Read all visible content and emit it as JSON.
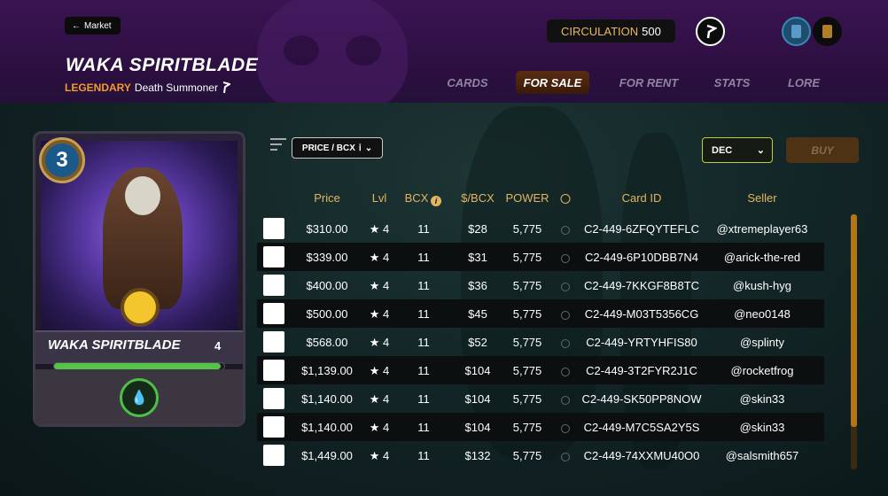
{
  "header": {
    "back_label": "Market",
    "title": "WAKA SPIRITBLADE",
    "rarity": "LEGENDARY",
    "class": "Death Summoner",
    "circulation_label": "CIRCULATION",
    "circulation_value": "500"
  },
  "tabs": [
    {
      "label": "CARDS",
      "active": false
    },
    {
      "label": "FOR SALE",
      "active": true
    },
    {
      "label": "FOR RENT",
      "active": false
    },
    {
      "label": "STATS",
      "active": false
    },
    {
      "label": "LORE",
      "active": false
    }
  ],
  "card": {
    "mana": "3",
    "name": "WAKA SPIRITBLADE",
    "level": "4",
    "xp_fraction": 0.98
  },
  "controls": {
    "sort_label": "PRICE / BCX",
    "order_label": "DEC",
    "buy_label": "BUY"
  },
  "table": {
    "headers": {
      "price": "Price",
      "lvl": "Lvl",
      "bcx": "BCX",
      "per_bcx": "$/BCX",
      "power": "POWER",
      "card_id": "Card ID",
      "seller": "Seller"
    },
    "rows": [
      {
        "price": "$310.00",
        "lvl": "★ 4",
        "bcx": "11",
        "per_bcx": "$28",
        "power": "5,775",
        "card_id": "C2-449-6ZFQYTEFLC",
        "seller": "@xtremeplayer63"
      },
      {
        "price": "$339.00",
        "lvl": "★ 4",
        "bcx": "11",
        "per_bcx": "$31",
        "power": "5,775",
        "card_id": "C2-449-6P10DBB7N4",
        "seller": "@arick-the-red"
      },
      {
        "price": "$400.00",
        "lvl": "★ 4",
        "bcx": "11",
        "per_bcx": "$36",
        "power": "5,775",
        "card_id": "C2-449-7KKGF8B8TC",
        "seller": "@kush-hyg"
      },
      {
        "price": "$500.00",
        "lvl": "★ 4",
        "bcx": "11",
        "per_bcx": "$45",
        "power": "5,775",
        "card_id": "C2-449-M03T5356CG",
        "seller": "@neo0148"
      },
      {
        "price": "$568.00",
        "lvl": "★ 4",
        "bcx": "11",
        "per_bcx": "$52",
        "power": "5,775",
        "card_id": "C2-449-YRTYHFIS80",
        "seller": "@splinty"
      },
      {
        "price": "$1,139.00",
        "lvl": "★ 4",
        "bcx": "11",
        "per_bcx": "$104",
        "power": "5,775",
        "card_id": "C2-449-3T2FYR2J1C",
        "seller": "@rocketfrog"
      },
      {
        "price": "$1,140.00",
        "lvl": "★ 4",
        "bcx": "11",
        "per_bcx": "$104",
        "power": "5,775",
        "card_id": "C2-449-SK50PP8NOW",
        "seller": "@skin33"
      },
      {
        "price": "$1,140.00",
        "lvl": "★ 4",
        "bcx": "11",
        "per_bcx": "$104",
        "power": "5,775",
        "card_id": "C2-449-M7C5SA2Y5S",
        "seller": "@skin33"
      },
      {
        "price": "$1,449.00",
        "lvl": "★ 4",
        "bcx": "11",
        "per_bcx": "$132",
        "power": "5,775",
        "card_id": "C2-449-74XXMU40O0",
        "seller": "@salsmith657"
      }
    ]
  },
  "colors": {
    "accent_gold": "#e3b560",
    "rarity_orange": "#f29a2e",
    "header_purple": "#3a1452"
  }
}
